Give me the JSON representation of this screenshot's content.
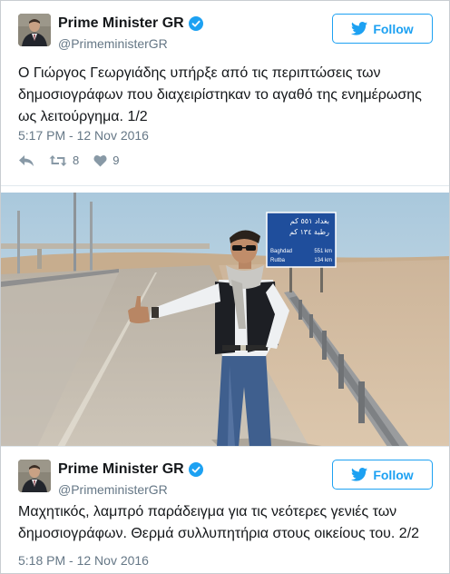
{
  "tweets": [
    {
      "name": "Prime Minister GR",
      "handle": "@PrimeministerGR",
      "follow_label": "Follow",
      "text": "Ο Γιώργος Γεωργιάδης υπήρξε από τις περιπτώσεις των δημοσιογράφων που διαχειρίστηκαν το αγαθό της ενημέρωσης ως λειτούργημα. 1/2",
      "timestamp": "5:17 PM - 12 Nov 2016",
      "retweets": "8",
      "likes": "9"
    },
    {
      "name": "Prime Minister GR",
      "handle": "@PrimeministerGR",
      "follow_label": "Follow",
      "text": "Μαχητικός, λαμπρό παράδειγμα για τις νεότερες γενιές των δημοσιογράφων. Θερμά συλλυπητήρια στους οικείους του. 2/2",
      "timestamp": "5:18 PM - 12 Nov 2016"
    }
  ],
  "photo": {
    "road_sign": {
      "arabic_line1": "بغداد ٥٥١ كم",
      "arabic_line2": "رطبة ١٣٤ كم",
      "rows": [
        {
          "place": "Baghdad",
          "distance": "551 km"
        },
        {
          "place": "Rutba",
          "distance": "134 km"
        }
      ]
    }
  },
  "icons": {
    "reply": "reply-icon",
    "retweet": "retweet-icon",
    "like": "heart-icon",
    "verified": "verified-badge-icon",
    "bird": "twitter-bird-icon"
  },
  "colors": {
    "twitter_blue": "#1da1f2",
    "text": "#14171a",
    "muted": "#657786",
    "sign_blue": "#1f4e9c"
  }
}
